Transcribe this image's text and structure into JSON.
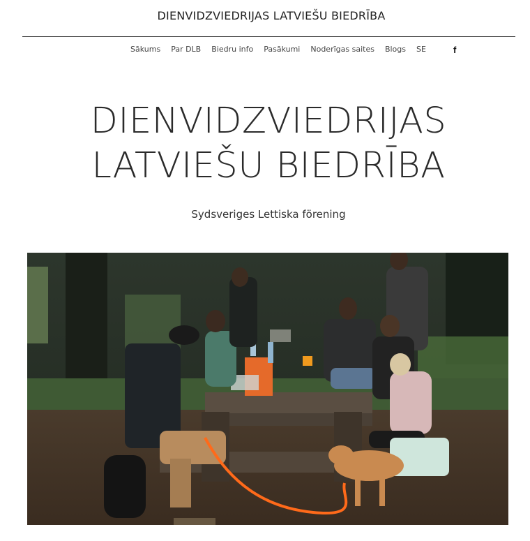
{
  "header": {
    "site_title": "DIENVIDZVIEDRIJAS LATVIEŠU BIEDRĪBA"
  },
  "nav": {
    "items": [
      "Sākums",
      "Par DLB",
      "Biedru info",
      "Pasākumi",
      "Noderīgas saites",
      "Blogs",
      "SE"
    ],
    "social_icon": "facebook-icon"
  },
  "hero": {
    "title_line1": "DIENVIDZVIEDRIJAS",
    "title_line2": "LATVIEŠU BIEDRĪBA",
    "subtitle": "Sydsveriges Lettiska förening"
  },
  "colors": {
    "background": "#ffffff",
    "text": "#2b2b2b",
    "rule": "#333333"
  }
}
